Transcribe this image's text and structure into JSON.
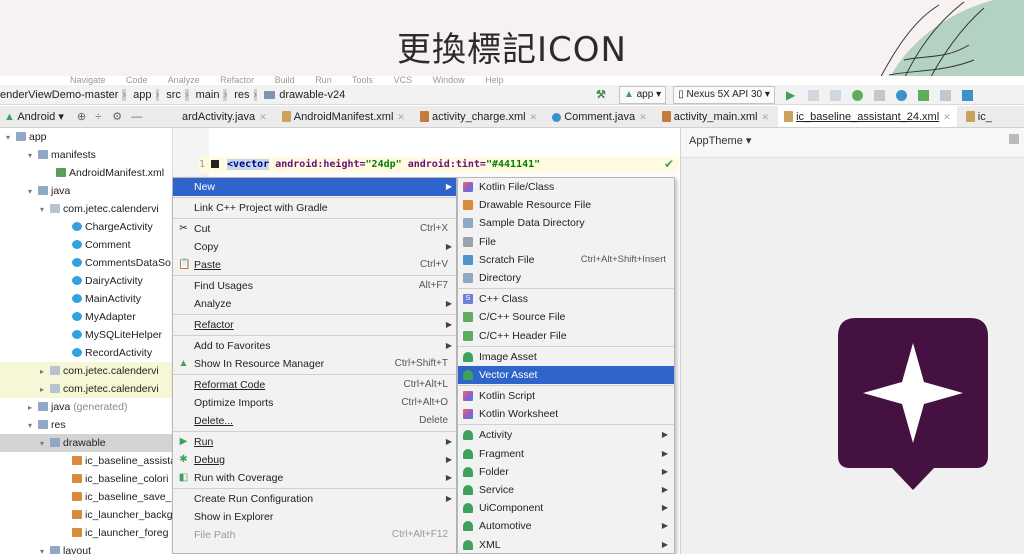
{
  "slide": {
    "title": "更換標記ICON"
  },
  "menubar": {
    "items": [
      "Navigate",
      "Code",
      "Analyze",
      "Refactor",
      "Build",
      "Run",
      "Tools",
      "VCS",
      "Window",
      "Help"
    ]
  },
  "navbar": {
    "project": "enderViewDemo-master",
    "path": [
      "app",
      "src",
      "main",
      "res",
      "drawable-v24"
    ],
    "run_config": "app",
    "device": "Nexus 5X API 30"
  },
  "project_view": {
    "selector": "Android"
  },
  "tabs": [
    {
      "label": "ardActivity.java"
    },
    {
      "label": "AndroidManifest.xml"
    },
    {
      "label": "activity_charge.xml"
    },
    {
      "label": "Comment.java"
    },
    {
      "label": "activity_main.xml"
    },
    {
      "label": "ic_baseline_assistant_24.xml"
    },
    {
      "label": "ic_"
    }
  ],
  "tree": [
    {
      "label": "app"
    },
    {
      "label": "manifests"
    },
    {
      "label": "AndroidManifest.xml"
    },
    {
      "label": "java"
    },
    {
      "label": "com.jetec.calendervi"
    },
    {
      "label": "ChargeActivity"
    },
    {
      "label": "Comment"
    },
    {
      "label": "CommentsDataSo"
    },
    {
      "label": "DairyActivity"
    },
    {
      "label": "MainActivity"
    },
    {
      "label": "MyAdapter"
    },
    {
      "label": "MySQLiteHelper"
    },
    {
      "label": "RecordActivity"
    },
    {
      "label": "com.jetec.calendervi"
    },
    {
      "label": "com.jetec.calendervi"
    },
    {
      "label": "java",
      "suffix": "(generated)"
    },
    {
      "label": "res"
    },
    {
      "label": "drawable"
    },
    {
      "label": "ic_baseline_assista"
    },
    {
      "label": "ic_baseline_colori"
    },
    {
      "label": "ic_baseline_save_"
    },
    {
      "label": "ic_launcher_backg"
    },
    {
      "label": "ic_launcher_foreg"
    },
    {
      "label": "layout"
    }
  ],
  "editor": {
    "line_number": "1",
    "tag": "<vector",
    "attr1": "android:height=",
    "val1": "\"24dp\"",
    "attr2": "android:tint=",
    "val2": "\"#441141\""
  },
  "preview": {
    "theme": "AppTheme",
    "icon_color": "#441141"
  },
  "context_menu": [
    {
      "label": "New",
      "submenu": true,
      "highlighted": true
    },
    {
      "label": "Link C++ Project with Gradle"
    },
    {
      "label": "Cut",
      "shortcut": "Ctrl+X",
      "icon": "scissors-icon"
    },
    {
      "label": "Copy",
      "submenu": true
    },
    {
      "label": "Paste",
      "shortcut": "Ctrl+V",
      "icon": "clipboard-icon"
    },
    {
      "label": "Find Usages",
      "shortcut": "Alt+F7"
    },
    {
      "label": "Analyze",
      "submenu": true
    },
    {
      "label": "Refactor",
      "submenu": true
    },
    {
      "label": "Add to Favorites",
      "submenu": true
    },
    {
      "label": "Show In Resource Manager",
      "shortcut": "Ctrl+Shift+T",
      "icon": "resource-manager-icon"
    },
    {
      "label": "Reformat Code",
      "shortcut": "Ctrl+Alt+L"
    },
    {
      "label": "Optimize Imports",
      "shortcut": "Ctrl+Alt+O"
    },
    {
      "label": "Delete...",
      "shortcut": "Delete"
    },
    {
      "label": "Run",
      "submenu": true,
      "icon": "run-icon"
    },
    {
      "label": "Debug",
      "submenu": true,
      "icon": "debug-icon"
    },
    {
      "label": "Run with Coverage",
      "submenu": true,
      "icon": "coverage-icon"
    },
    {
      "label": "Create Run Configuration",
      "submenu": true
    },
    {
      "label": "Show in Explorer"
    },
    {
      "label": "File Path",
      "shortcut": "Ctrl+Alt+F12",
      "disabled": true
    }
  ],
  "new_submenu": [
    {
      "label": "Kotlin File/Class",
      "icon": "kotlin-icon"
    },
    {
      "label": "Drawable Resource File",
      "icon": "image-file-icon"
    },
    {
      "label": "Sample Data Directory",
      "icon": "folder-icon"
    },
    {
      "label": "File",
      "icon": "file-icon"
    },
    {
      "label": "Scratch File",
      "shortcut": "Ctrl+Alt+Shift+Insert",
      "icon": "scratch-icon"
    },
    {
      "label": "Directory",
      "icon": "folder-icon"
    },
    {
      "label": "C++ Class",
      "icon": "cpp-icon"
    },
    {
      "label": "C/C++ Source File",
      "icon": "cpp-file-icon"
    },
    {
      "label": "C/C++ Header File",
      "icon": "cpp-file-icon"
    },
    {
      "label": "Image Asset",
      "icon": "android-icon"
    },
    {
      "label": "Vector Asset",
      "icon": "android-icon",
      "highlighted": true
    },
    {
      "label": "Kotlin Script",
      "icon": "kotlin-icon"
    },
    {
      "label": "Kotlin Worksheet",
      "icon": "kotlin-icon"
    },
    {
      "label": "Activity",
      "icon": "android-icon",
      "submenu": true
    },
    {
      "label": "Fragment",
      "icon": "android-icon",
      "submenu": true
    },
    {
      "label": "Folder",
      "icon": "android-icon",
      "submenu": true
    },
    {
      "label": "Service",
      "icon": "android-icon",
      "submenu": true
    },
    {
      "label": "UiComponent",
      "icon": "android-icon",
      "submenu": true
    },
    {
      "label": "Automotive",
      "icon": "android-icon",
      "submenu": true
    },
    {
      "label": "XML",
      "icon": "android-icon",
      "submenu": true
    }
  ]
}
